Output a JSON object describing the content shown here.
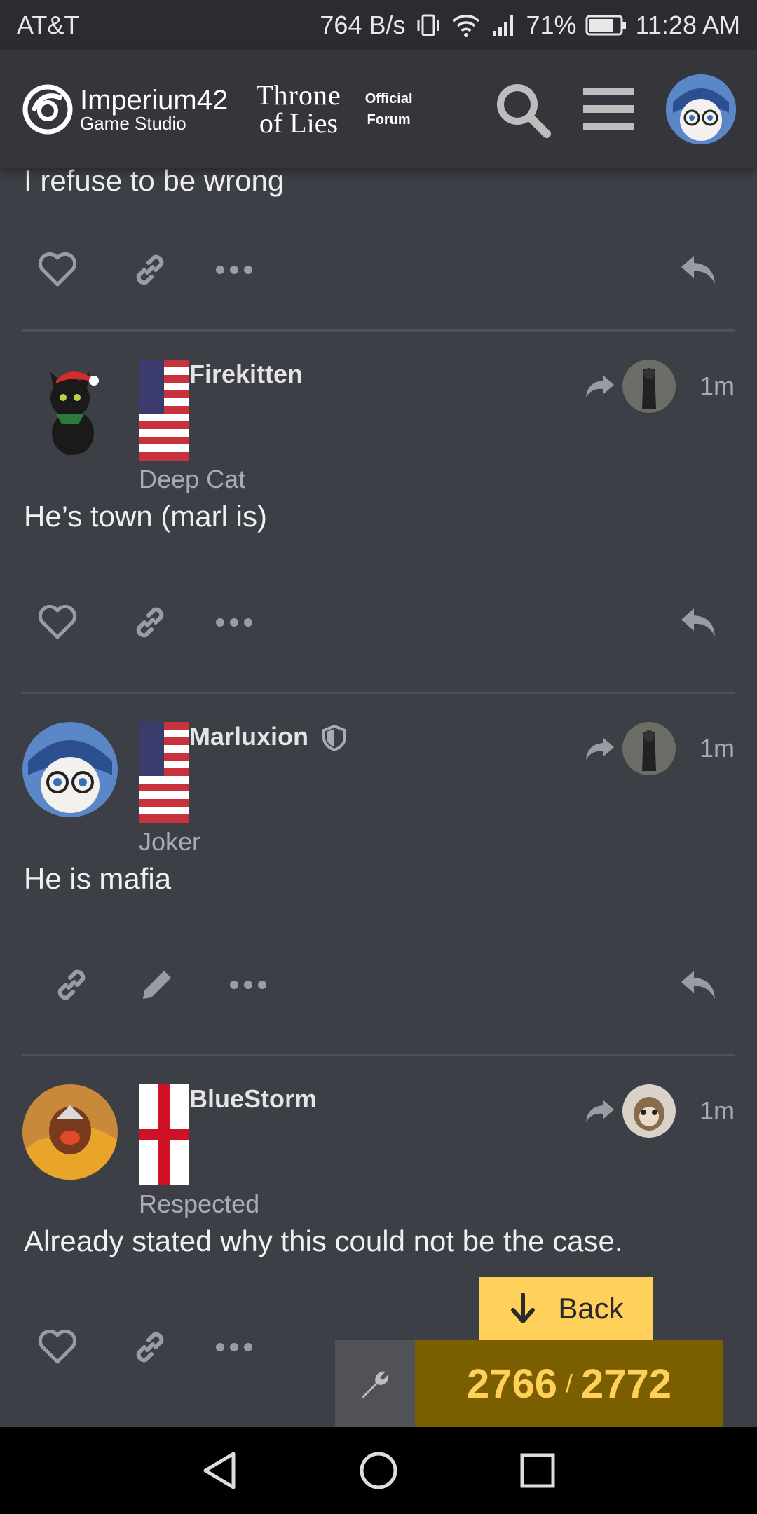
{
  "status_bar": {
    "carrier": "AT&T",
    "speed": "764 B/s",
    "battery": "71%",
    "time": "11:28 AM"
  },
  "header": {
    "logo_main": "Imperium42",
    "logo_sub": "Game Studio",
    "game_title_1": "Throne",
    "game_title_2": "of Lies",
    "official_1": "Official",
    "official_2": "Forum"
  },
  "posts": [
    {
      "text": "I refuse to be wrong"
    },
    {
      "username": "Firekitten",
      "user_title": "Deep Cat",
      "ago": "1m",
      "text": "He’s town (marl is)"
    },
    {
      "username": "Marluxion",
      "user_title": "Joker",
      "ago": "1m",
      "text": "He is mafia"
    },
    {
      "username": "BlueStorm",
      "user_title": "Respected",
      "ago": "1m",
      "text": "Already stated why this could not be the case."
    }
  ],
  "floating": {
    "back_label": "Back",
    "current": "2766",
    "separator": "/",
    "total": "2772"
  },
  "colors": {
    "accent": "#ffd05a",
    "progress_bg": "#7a5e00",
    "page_bg": "#3d3f47"
  }
}
